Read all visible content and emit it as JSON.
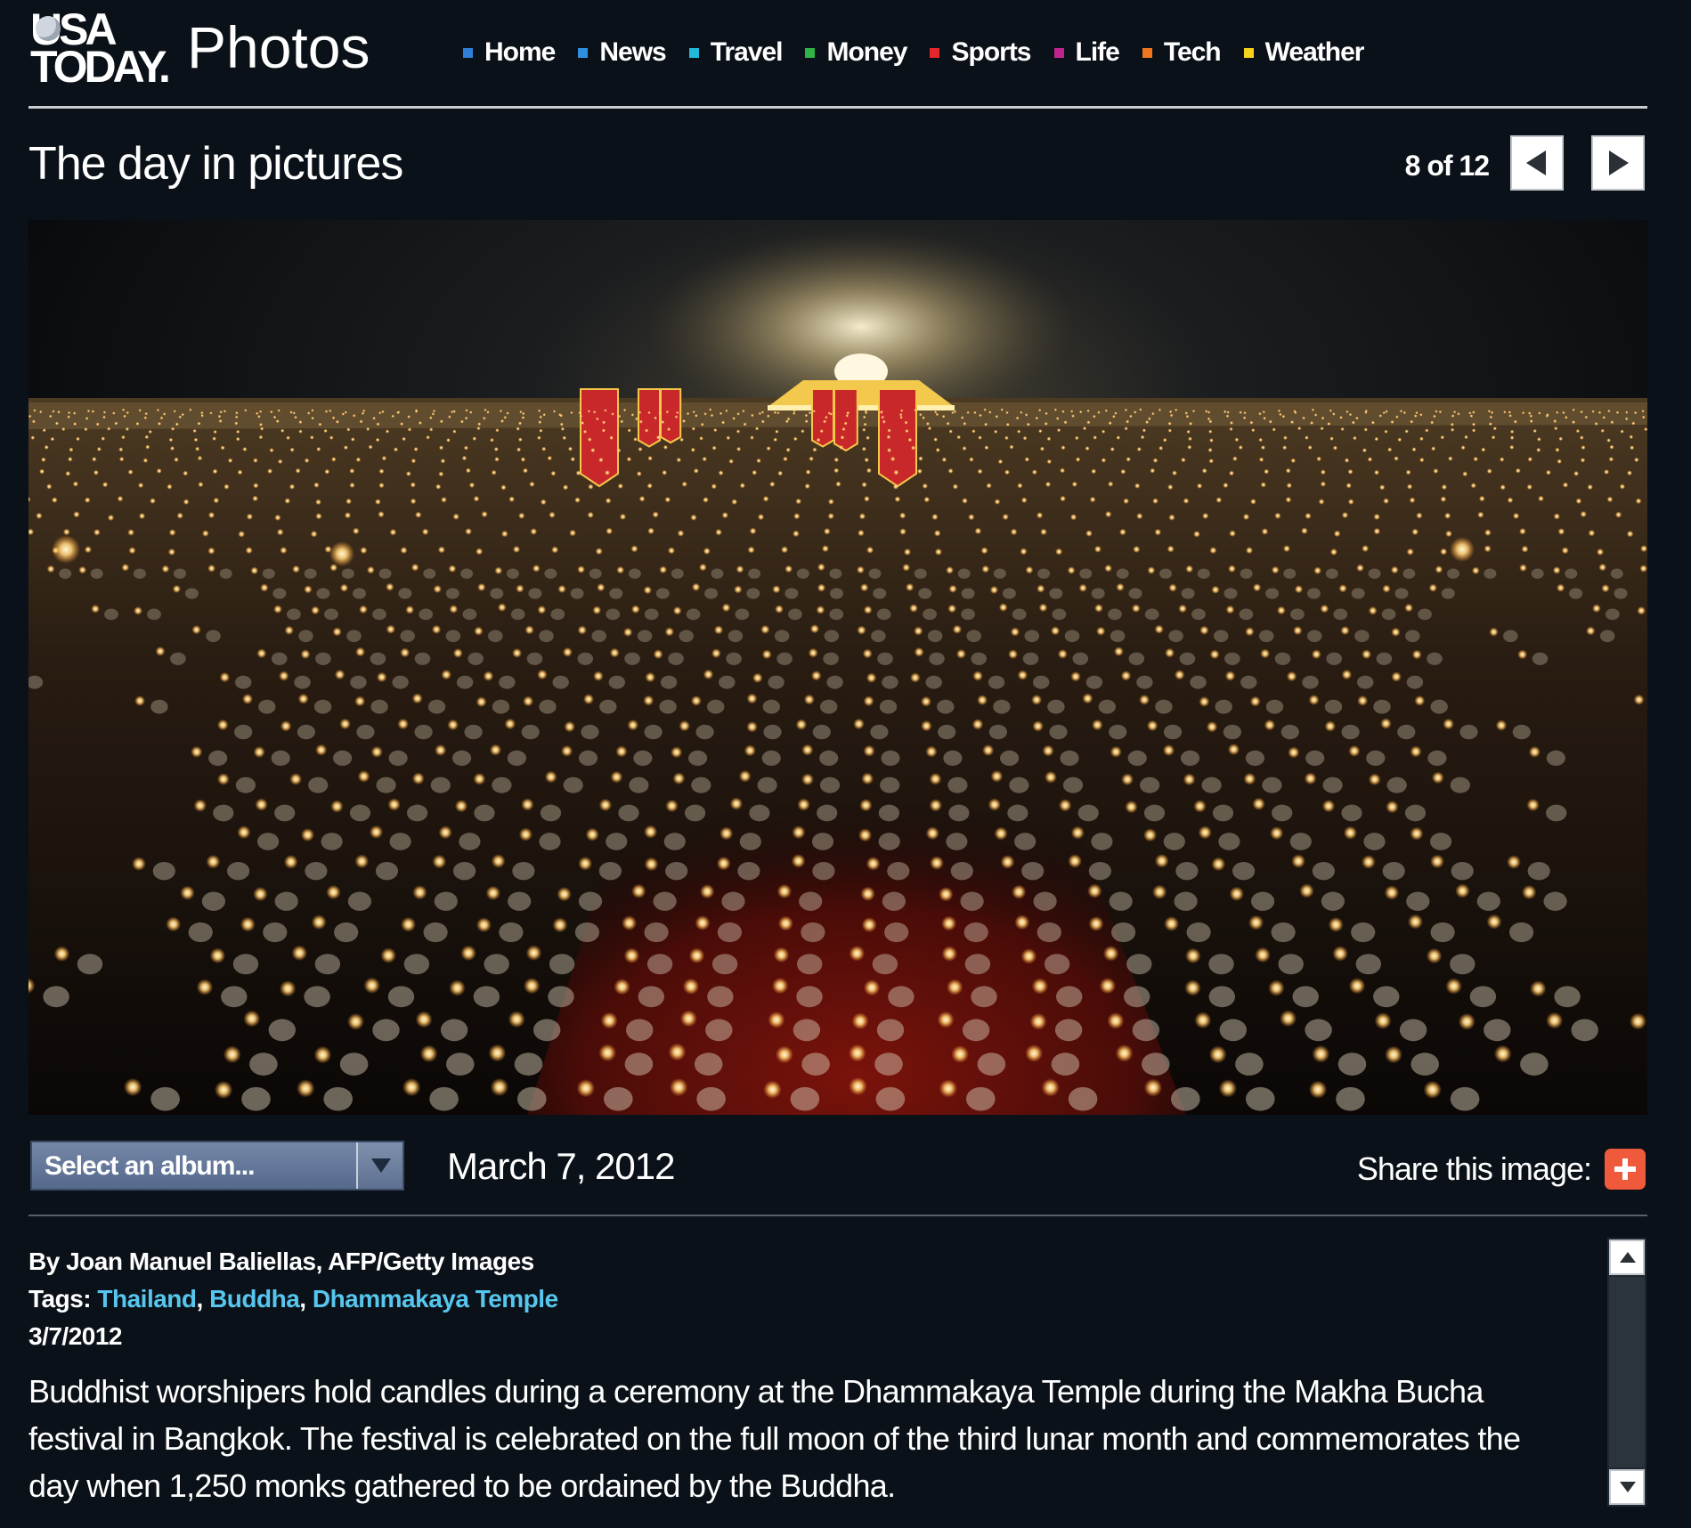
{
  "header": {
    "logo_text": "USA\nTODAY.",
    "section_title": "Photos",
    "nav": [
      {
        "label": "Home",
        "color": "#2f7fd9",
        "icon": "square-bullet-icon"
      },
      {
        "label": "News",
        "color": "#2f8fe0",
        "icon": "square-bullet-icon"
      },
      {
        "label": "Travel",
        "color": "#22b9d9",
        "icon": "square-bullet-icon"
      },
      {
        "label": "Money",
        "color": "#2fb24a",
        "icon": "square-bullet-icon"
      },
      {
        "label": "Sports",
        "color": "#e5262a",
        "icon": "square-bullet-icon"
      },
      {
        "label": "Life",
        "color": "#c0258f",
        "icon": "square-bullet-icon"
      },
      {
        "label": "Tech",
        "color": "#f0761e",
        "icon": "square-bullet-icon"
      },
      {
        "label": "Weather",
        "color": "#f4d21e",
        "icon": "square-bullet-icon"
      }
    ]
  },
  "gallery": {
    "title": "The day in pictures",
    "counter": "8 of 12",
    "current": 8,
    "total": 12,
    "prev_icon": "arrow-left-icon",
    "next_icon": "arrow-right-icon"
  },
  "controls": {
    "album_select": "Select an album...",
    "date": "March 7, 2012",
    "share_label": "Share this image:",
    "share_icon": "plus-icon",
    "share_color": "#ef5a3d"
  },
  "caption": {
    "credit": "By Joan Manuel Baliellas, AFP/Getty Images",
    "tags_label": "Tags:",
    "tags": [
      "Thailand",
      "Buddha",
      "Dhammakaya Temple"
    ],
    "separator": ",",
    "date": "3/7/2012",
    "text": "Buddhist worshipers hold candles during a ceremony at the Dhammakaya Temple during the Makha Bucha festival in Bangkok. The festival is celebrated on the full moon of the third lunar month and commemorates the day when 1,250 monks gathered to be ordained by the Buddha.",
    "link_color": "#56c6ee"
  }
}
